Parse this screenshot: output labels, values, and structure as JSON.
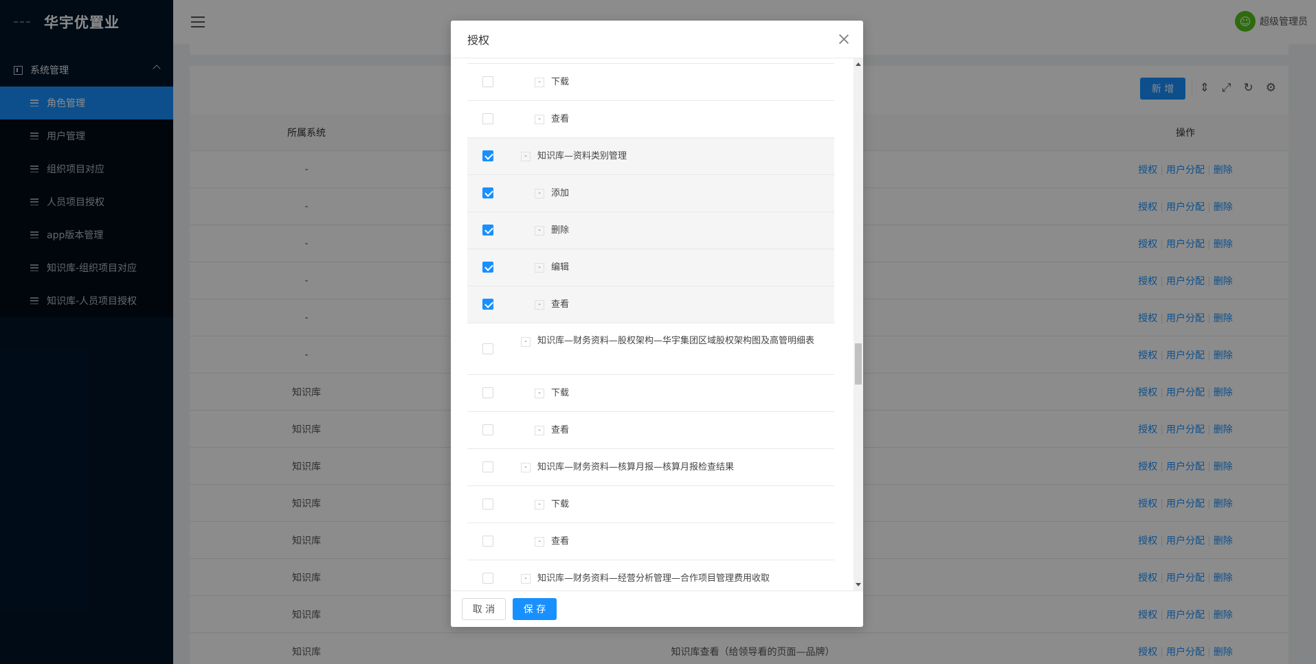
{
  "brand": {
    "name": "华宇优置业"
  },
  "sidebar": {
    "group_label": "系统管理",
    "items": [
      {
        "label": "角色管理",
        "active": true
      },
      {
        "label": "用户管理",
        "active": false
      },
      {
        "label": "组织项目对应",
        "active": false
      },
      {
        "label": "人员项目授权",
        "active": false
      },
      {
        "label": "app版本管理",
        "active": false
      },
      {
        "label": "知识库-组织项目对应",
        "active": false
      },
      {
        "label": "知识库-人员项目授权",
        "active": false
      }
    ]
  },
  "header": {
    "user_name": "超级管理员"
  },
  "toolbar": {
    "new_label": "新 增"
  },
  "table": {
    "headers": {
      "system": "所属系统",
      "operation": "操作"
    },
    "ops": {
      "auth": "授权",
      "assign": "用户分配",
      "delete": "删除"
    },
    "rows": [
      {
        "system": "-",
        "name": ""
      },
      {
        "system": "-",
        "name": ""
      },
      {
        "system": "-",
        "name": ""
      },
      {
        "system": "-",
        "name": ""
      },
      {
        "system": "-",
        "name": ""
      },
      {
        "system": "-",
        "name": ""
      },
      {
        "system": "知识库",
        "name": ""
      },
      {
        "system": "知识库",
        "name": ""
      },
      {
        "system": "知识库",
        "name": ""
      },
      {
        "system": "知识库",
        "name": ""
      },
      {
        "system": "知识库",
        "name": ""
      },
      {
        "system": "知识库",
        "name": ""
      },
      {
        "system": "知识库",
        "name": ""
      },
      {
        "system": "知识库",
        "name": "知识库查看（给领导看的页面—品牌）"
      }
    ]
  },
  "modal": {
    "title": "授权",
    "cancel_label": "取 消",
    "save_label": "保 存",
    "tree": [
      {
        "label": "下载",
        "level": 2,
        "checked": false
      },
      {
        "label": "查看",
        "level": 2,
        "checked": false
      },
      {
        "label": "知识库—资料类别管理",
        "level": 1,
        "checked": true
      },
      {
        "label": "添加",
        "level": 2,
        "checked": true
      },
      {
        "label": "删除",
        "level": 2,
        "checked": true
      },
      {
        "label": "编辑",
        "level": 2,
        "checked": true
      },
      {
        "label": "查看",
        "level": 2,
        "checked": true
      },
      {
        "label": "知识库—财务资料—股权架构—华宇集团区域股权架构图及高管明细表",
        "level": 1,
        "checked": false,
        "wrap": true
      },
      {
        "label": "下载",
        "level": 2,
        "checked": false
      },
      {
        "label": "查看",
        "level": 2,
        "checked": false
      },
      {
        "label": "知识库—财务资料—核算月报—核算月报检查结果",
        "level": 1,
        "checked": false
      },
      {
        "label": "下载",
        "level": 2,
        "checked": false
      },
      {
        "label": "查看",
        "level": 2,
        "checked": false
      },
      {
        "label": "知识库—财务资料—经营分析管理—合作项目管理费用收取",
        "level": 1,
        "checked": false
      }
    ]
  },
  "colors": {
    "primary": "#1890ff",
    "sidebar_bg": "#001529",
    "avatar": "#52c41a"
  }
}
